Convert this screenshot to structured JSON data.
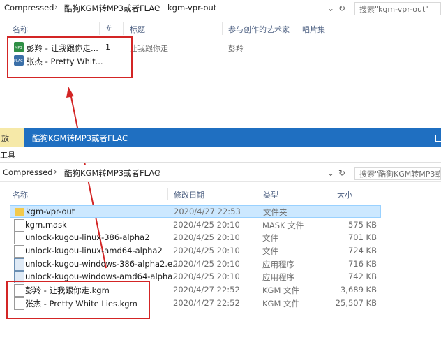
{
  "top_window": {
    "breadcrumb": [
      "Compressed",
      "酷狗KGM转MP3或者FLAC",
      "kgm-vpr-out"
    ],
    "search_placeholder": "搜索\"kgm-vpr-out\"",
    "columns": [
      "名称",
      "#",
      "标题",
      "参与创作的艺术家",
      "唱片集"
    ],
    "files": [
      {
        "name": "彭羚 - 让我跟你走...",
        "icon_label": "MP3",
        "number": "1",
        "title": "让我跟你走",
        "artist": "彭羚"
      },
      {
        "name": "张杰 - Pretty Whit...",
        "icon_label": "FLAC",
        "number": "",
        "title": "",
        "artist": ""
      }
    ]
  },
  "bottom_window": {
    "title": "酷狗KGM转MP3或者FLAC",
    "ribbon_tab_partial": "放",
    "ribbon_tool_partial": "工具",
    "breadcrumb": [
      "Compressed",
      "酷狗KGM转MP3或者FLAC"
    ],
    "search_placeholder": "搜索\"酷狗KGM转MP3或者",
    "columns": [
      "名称",
      "修改日期",
      "类型",
      "大小"
    ],
    "files": [
      {
        "name": "kgm-vpr-out",
        "icon": "folder",
        "date": "2020/4/27 22:53",
        "type": "文件夹",
        "size": "",
        "selected": true
      },
      {
        "name": "kgm.mask",
        "icon": "file",
        "date": "2020/4/25 20:10",
        "type": "MASK 文件",
        "size": "575 KB"
      },
      {
        "name": "unlock-kugou-linux-386-alpha2",
        "icon": "file",
        "date": "2020/4/25 20:10",
        "type": "文件",
        "size": "701 KB"
      },
      {
        "name": "unlock-kugou-linux-amd64-alpha2",
        "icon": "file",
        "date": "2020/4/25 20:10",
        "type": "文件",
        "size": "724 KB"
      },
      {
        "name": "unlock-kugou-windows-386-alpha2.e...",
        "icon": "app",
        "date": "2020/4/25 20:10",
        "type": "应用程序",
        "size": "716 KB"
      },
      {
        "name": "unlock-kugou-windows-amd64-alpha...",
        "icon": "app",
        "date": "2020/4/25 20:10",
        "type": "应用程序",
        "size": "742 KB"
      },
      {
        "name": "彭羚 - 让我跟你走.kgm",
        "icon": "file",
        "date": "2020/4/27 22:52",
        "type": "KGM 文件",
        "size": "3,689 KB"
      },
      {
        "name": "张杰 - Pretty White Lies.kgm",
        "icon": "file",
        "date": "2020/4/27 22:52",
        "type": "KGM 文件",
        "size": "25,507 KB"
      }
    ]
  },
  "colors": {
    "annotation": "#d32525",
    "title_bar": "#1f6fc1",
    "selection": "#cce8ff"
  }
}
